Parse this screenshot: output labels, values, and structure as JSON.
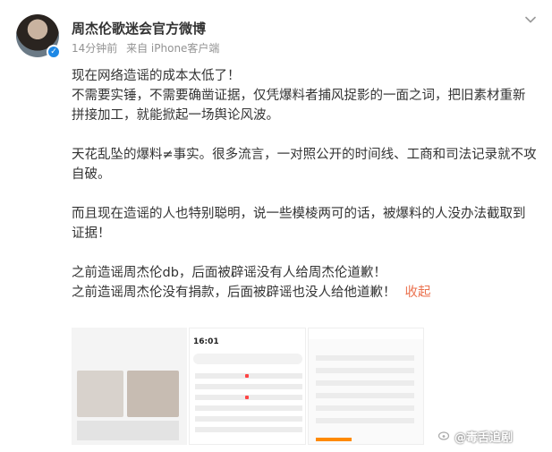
{
  "post": {
    "author": "周杰伦歌迷会官方微博",
    "time": "14分钟前",
    "source": "来自 iPhone客户端",
    "paragraphs": [
      [
        "现在网络造谣的成本太低了！",
        "不需要实锤，不需要确凿证据，仅凭爆料者捕风捉影的一面之词，把旧素材重新拼接加工，就能掀起一场舆论风波。"
      ],
      [
        "天花乱坠的爆料≠事实。很多流言，一对照公开的时间线、工商和司法记录就不攻自破。"
      ],
      [
        "而且现在造谣的人也特别聪明，说一些模棱两可的话，被爆料的人没办法截取到证据！"
      ],
      [
        "之前造谣周杰伦db，后面被辟谣没有人给周杰伦道歉！",
        "之前造谣周杰伦没有捐款，后面被辟谣也没人给他道歉！"
      ]
    ],
    "collapse_label": "收起"
  },
  "watermark": "@毒舌追剧",
  "thumbnails": {
    "img2_time": "16:01"
  },
  "colors": {
    "accent": "#eb7350",
    "verify": "#1e88e5"
  },
  "icons": [
    "avatar",
    "verified-badge-icon",
    "chevron-down-icon",
    "weibo-logo-icon"
  ]
}
